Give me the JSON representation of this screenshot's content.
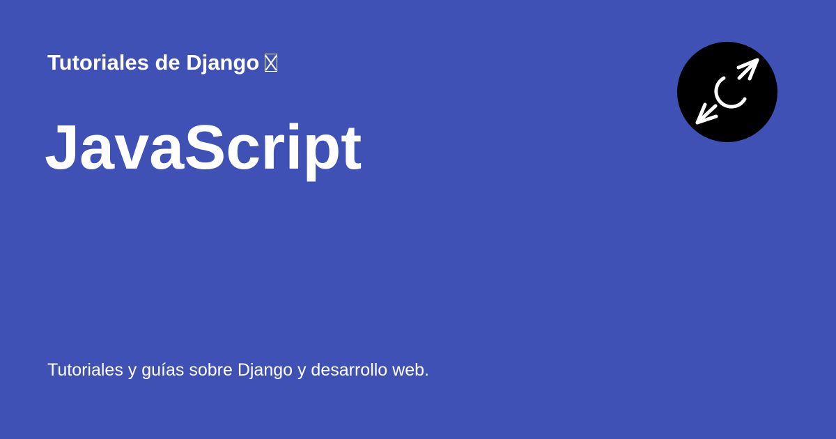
{
  "site": {
    "name": "Tutoriales de Django",
    "emoji_icon": "missing-glyph-icon"
  },
  "page": {
    "title": "JavaScript",
    "description": "Tutoriales y guías sobre Django y desarrollo web."
  },
  "logo": {
    "icon": "compass-arrows-logo-icon"
  },
  "colors": {
    "background": "#3f51b5",
    "text": "#ffffff",
    "logo_background": "#000000",
    "logo_stroke": "#ffffff"
  }
}
